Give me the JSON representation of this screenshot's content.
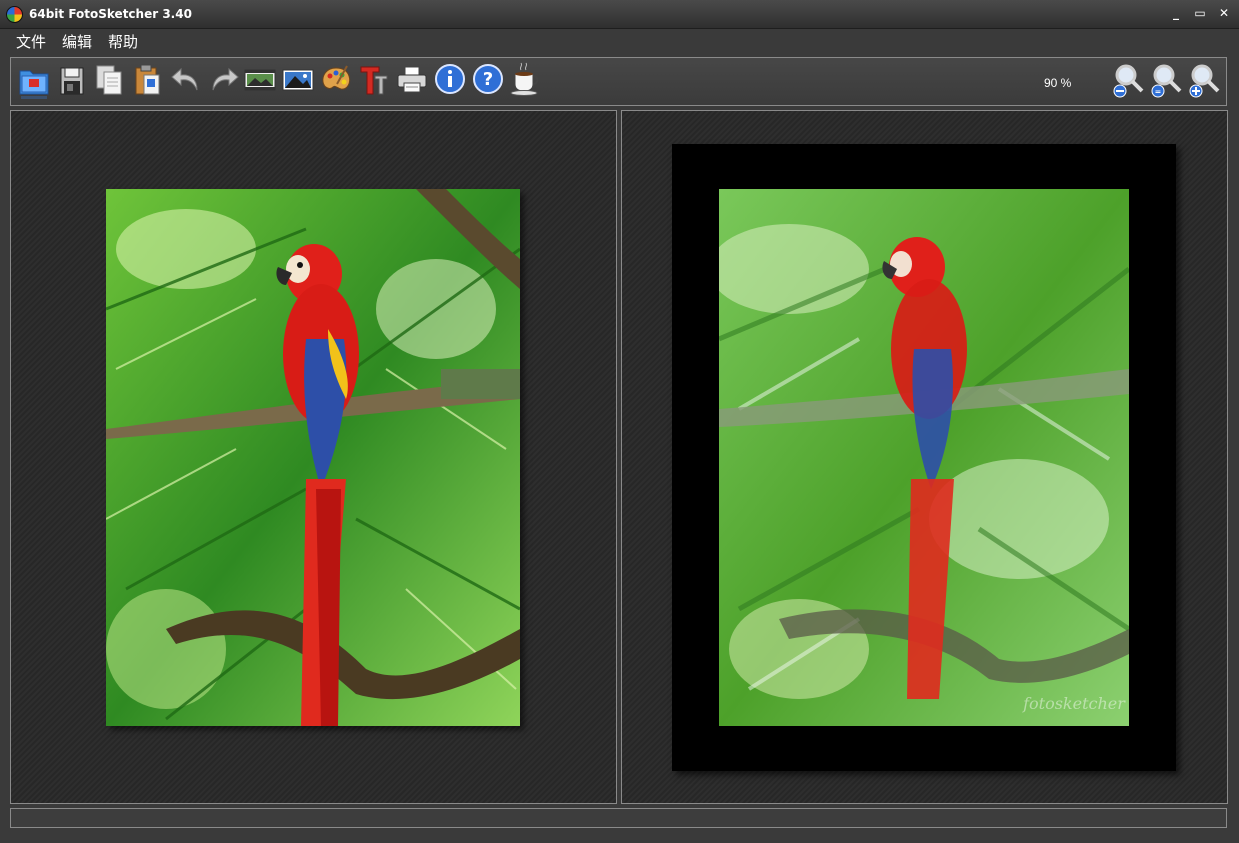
{
  "window": {
    "title": "64bit FotoSketcher 3.40",
    "controls": {
      "minimize": "_",
      "maximize": "▭",
      "close": "✕"
    }
  },
  "menu": {
    "items": [
      {
        "label": "文件"
      },
      {
        "label": "编辑"
      },
      {
        "label": "帮助"
      }
    ]
  },
  "toolbar": {
    "tools": [
      {
        "icon": "open-folder-icon"
      },
      {
        "icon": "save-icon"
      },
      {
        "icon": "copy-icon"
      },
      {
        "icon": "paste-icon"
      },
      {
        "icon": "undo-icon"
      },
      {
        "icon": "redo-icon"
      },
      {
        "icon": "filmstrip-icon"
      },
      {
        "icon": "landscape-image-icon"
      },
      {
        "icon": "palette-icon"
      },
      {
        "icon": "text-icon"
      },
      {
        "icon": "printer-icon"
      },
      {
        "icon": "info-icon"
      },
      {
        "icon": "help-icon"
      },
      {
        "icon": "coffee-cup-icon"
      }
    ],
    "zoom_value": "90 %",
    "zoom_buttons": [
      {
        "icon": "zoom-out-icon"
      },
      {
        "icon": "zoom-fit-icon"
      },
      {
        "icon": "zoom-in-icon"
      }
    ]
  },
  "images": {
    "sketch_watermark": "fotosketcher"
  },
  "statusbar": {
    "text": ""
  },
  "colors": {
    "background": "#3a3a3a",
    "panel": "#2b2b2b",
    "border": "#8a8a8a",
    "parrot_red": "#e0201a",
    "parrot_blue": "#2d4fa8",
    "foliage": "#4da12a"
  }
}
